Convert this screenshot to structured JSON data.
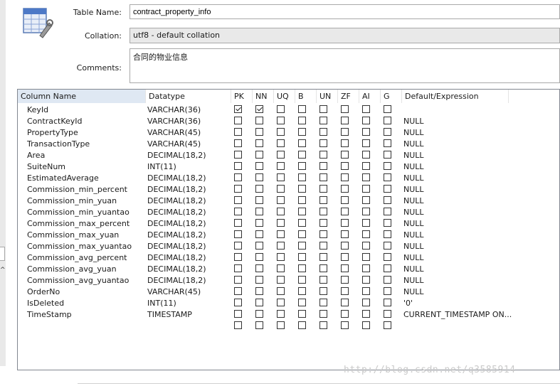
{
  "form": {
    "table_name_label": "Table Name:",
    "table_name_value": "contract_property_info",
    "collation_label": "Collation:",
    "collation_value": "utf8 - default collation",
    "comments_label": "Comments:",
    "comments_value": "合同的物业信息"
  },
  "grid": {
    "headers": [
      "Column Name",
      "Datatype",
      "PK",
      "NN",
      "UQ",
      "B",
      "UN",
      "ZF",
      "AI",
      "G",
      "Default/Expression"
    ],
    "rows": [
      {
        "name": "KeyId",
        "type": "VARCHAR(36)",
        "pk": true,
        "nn": true,
        "default": ""
      },
      {
        "name": "ContractKeyId",
        "type": "VARCHAR(36)",
        "pk": false,
        "nn": false,
        "default": "NULL"
      },
      {
        "name": "PropertyType",
        "type": "VARCHAR(45)",
        "pk": false,
        "nn": false,
        "default": "NULL"
      },
      {
        "name": "TransactionType",
        "type": "VARCHAR(45)",
        "pk": false,
        "nn": false,
        "default": "NULL"
      },
      {
        "name": "Area",
        "type": "DECIMAL(18,2)",
        "pk": false,
        "nn": false,
        "default": "NULL"
      },
      {
        "name": "SuiteNum",
        "type": "INT(11)",
        "pk": false,
        "nn": false,
        "default": "NULL"
      },
      {
        "name": "EstimatedAverage",
        "type": "DECIMAL(18,2)",
        "pk": false,
        "nn": false,
        "default": "NULL"
      },
      {
        "name": "Commission_min_percent",
        "type": "DECIMAL(18,2)",
        "pk": false,
        "nn": false,
        "default": "NULL"
      },
      {
        "name": "Commission_min_yuan",
        "type": "DECIMAL(18,2)",
        "pk": false,
        "nn": false,
        "default": "NULL"
      },
      {
        "name": "Commission_min_yuantao",
        "type": "DECIMAL(18,2)",
        "pk": false,
        "nn": false,
        "default": "NULL"
      },
      {
        "name": "Commission_max_percent",
        "type": "DECIMAL(18,2)",
        "pk": false,
        "nn": false,
        "default": "NULL"
      },
      {
        "name": "Commission_max_yuan",
        "type": "DECIMAL(18,2)",
        "pk": false,
        "nn": false,
        "default": "NULL"
      },
      {
        "name": "Commission_max_yuantao",
        "type": "DECIMAL(18,2)",
        "pk": false,
        "nn": false,
        "default": "NULL"
      },
      {
        "name": "Commission_avg_percent",
        "type": "DECIMAL(18,2)",
        "pk": false,
        "nn": false,
        "default": "NULL"
      },
      {
        "name": "Commission_avg_yuan",
        "type": "DECIMAL(18,2)",
        "pk": false,
        "nn": false,
        "default": "NULL"
      },
      {
        "name": "Commission_avg_yuantao",
        "type": "DECIMAL(18,2)",
        "pk": false,
        "nn": false,
        "default": "NULL"
      },
      {
        "name": "OrderNo",
        "type": "VARCHAR(45)",
        "pk": false,
        "nn": false,
        "default": "NULL"
      },
      {
        "name": "IsDeleted",
        "type": "INT(11)",
        "pk": false,
        "nn": false,
        "default": "'0'"
      },
      {
        "name": "TimeStamp",
        "type": "TIMESTAMP",
        "pk": false,
        "nn": false,
        "default": "CURRENT_TIMESTAMP ON..."
      },
      {
        "name": "",
        "type": "",
        "pk": false,
        "nn": false,
        "default": ""
      }
    ]
  },
  "watermark": "http://blog.csdn.net/q3585914",
  "icons": {
    "table_editor": "table-edit-icon"
  }
}
